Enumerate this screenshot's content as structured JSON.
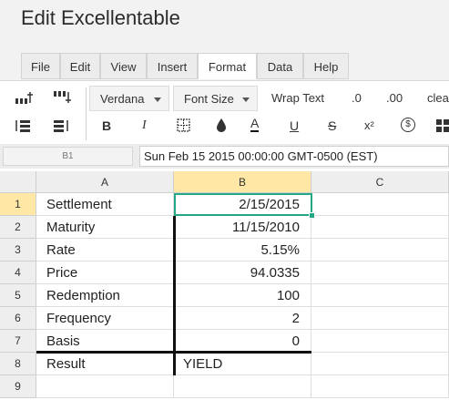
{
  "app": {
    "title": "Edit Excellentable"
  },
  "menu": {
    "tabs": [
      {
        "label": "File"
      },
      {
        "label": "Edit"
      },
      {
        "label": "View"
      },
      {
        "label": "Insert"
      },
      {
        "label": "Format",
        "active": true
      },
      {
        "label": "Data"
      },
      {
        "label": "Help"
      }
    ]
  },
  "toolbar": {
    "font_family": "Verdana",
    "font_size": "Font Size",
    "wrap_text": "Wrap Text",
    "decimal_decrease": ".0",
    "decimal_increase": ".00",
    "clear": "clea",
    "bold": "B",
    "italic": "I",
    "underline": "U",
    "strikethrough": "S",
    "superscript": "x²",
    "currency": "$",
    "font_color": "A"
  },
  "formula_bar": {
    "cell_ref": "B1",
    "value": "Sun Feb 15 2015 00:00:00 GMT-0500 (EST)"
  },
  "sheet": {
    "columns": [
      "A",
      "B",
      "C"
    ],
    "selected_column": "B",
    "selected_row": "1",
    "rows": [
      {
        "num": "1",
        "a": "Settlement",
        "b": "2/15/2015",
        "c": ""
      },
      {
        "num": "2",
        "a": "Maturity",
        "b": "11/15/2010",
        "c": ""
      },
      {
        "num": "3",
        "a": "Rate",
        "b": "5.15%",
        "c": ""
      },
      {
        "num": "4",
        "a": "Price",
        "b": "94.0335",
        "c": ""
      },
      {
        "num": "5",
        "a": "Redemption",
        "b": "100",
        "c": ""
      },
      {
        "num": "6",
        "a": "Frequency",
        "b": "2",
        "c": ""
      },
      {
        "num": "7",
        "a": "Basis",
        "b": "0",
        "c": ""
      },
      {
        "num": "8",
        "a": "Result",
        "b": "YIELD",
        "c": ""
      },
      {
        "num": "9",
        "a": "",
        "b": "",
        "c": ""
      }
    ]
  },
  "colors": {
    "selection": "#22a886",
    "header_highlight": "#ffe8a6"
  }
}
